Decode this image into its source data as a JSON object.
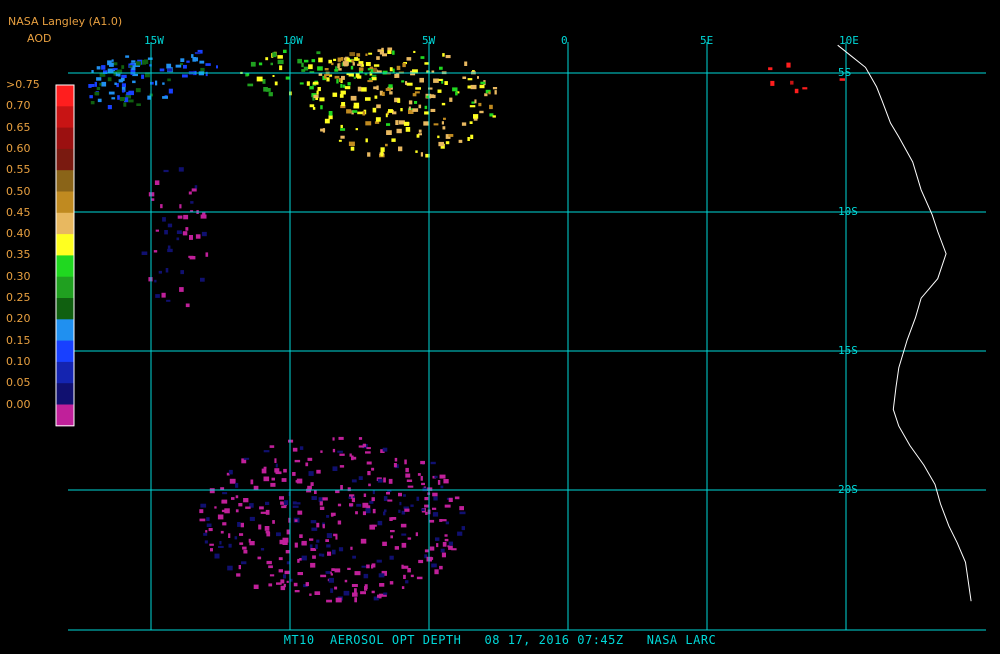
{
  "header": {
    "source": "NASA Langley (A1.0)",
    "variable": "AOD"
  },
  "footer": {
    "caption": "MT10  AEROSOL OPT DEPTH   08 17, 2016 07:45Z   NASA LARC"
  },
  "map": {
    "lon_range": [
      -18,
      12
    ],
    "lat_range": [
      -4,
      -24
    ],
    "coastline_color": "#ffffff",
    "grid_color": "#00d8d8",
    "lon_ticks": [
      {
        "lon": -15,
        "label": "15W"
      },
      {
        "lon": -10,
        "label": "10W"
      },
      {
        "lon": -5,
        "label": "5W"
      },
      {
        "lon": 0,
        "label": "0"
      },
      {
        "lon": 5,
        "label": "5E"
      },
      {
        "lon": 10,
        "label": "10E"
      }
    ],
    "lat_ticks": [
      {
        "lat": -5,
        "label": "5S"
      },
      {
        "lat": -10,
        "label": "10S"
      },
      {
        "lat": -15,
        "label": "15S"
      },
      {
        "lat": -20,
        "label": "20S"
      }
    ],
    "coastline": [
      [
        9.7,
        -4.0
      ],
      [
        10.2,
        -4.4
      ],
      [
        10.7,
        -4.8
      ],
      [
        11.1,
        -5.5
      ],
      [
        11.3,
        -6.0
      ],
      [
        11.6,
        -6.8
      ],
      [
        11.9,
        -7.3
      ],
      [
        12.4,
        -8.2
      ],
      [
        12.7,
        -9.2
      ],
      [
        13.1,
        -10.1
      ],
      [
        13.3,
        -10.7
      ],
      [
        13.6,
        -11.5
      ],
      [
        13.3,
        -12.4
      ],
      [
        12.7,
        -13.1
      ],
      [
        12.5,
        -13.8
      ],
      [
        12.2,
        -14.6
      ],
      [
        11.9,
        -15.6
      ],
      [
        11.8,
        -16.3
      ],
      [
        11.7,
        -17.1
      ],
      [
        11.9,
        -17.7
      ],
      [
        12.3,
        -18.4
      ],
      [
        12.8,
        -19.1
      ],
      [
        13.2,
        -19.8
      ],
      [
        13.4,
        -20.5
      ],
      [
        13.7,
        -21.3
      ],
      [
        14.0,
        -21.9
      ],
      [
        14.3,
        -22.6
      ],
      [
        14.4,
        -23.3
      ],
      [
        14.5,
        -24.0
      ]
    ],
    "aod_regions": [
      {
        "name": "blue cluster near 15W",
        "lon": -16.0,
        "lat": -5.3,
        "rx": 1.8,
        "ry": 1.0,
        "aod": 0.2,
        "density": 0.55
      },
      {
        "name": "blue cluster 13W",
        "lon": -13.6,
        "lat": -4.6,
        "rx": 1.0,
        "ry": 0.5,
        "aod": 0.18,
        "density": 0.5
      },
      {
        "name": "green band 10W",
        "lon": -9.5,
        "lat": -5.0,
        "rx": 2.5,
        "ry": 0.9,
        "aod": 0.35,
        "density": 0.35
      },
      {
        "name": "yellow band 7W",
        "lon": -6.0,
        "lat": -6.0,
        "rx": 3.5,
        "ry": 2.0,
        "aod": 0.42,
        "density": 0.3
      },
      {
        "name": "orange streaks 8W",
        "lon": -7.5,
        "lat": -4.7,
        "rx": 1.7,
        "ry": 0.6,
        "aod": 0.48,
        "density": 0.35
      },
      {
        "name": "red points 8E",
        "lon": 8.2,
        "lat": -5.3,
        "rx": 1.8,
        "ry": 0.8,
        "aod": 0.75,
        "density": 0.05
      },
      {
        "name": "magenta trail 14W",
        "lon": -14.2,
        "lat": -10.8,
        "rx": 1.2,
        "ry": 2.8,
        "aod": 0.0,
        "density": 0.15
      },
      {
        "name": "magenta field south",
        "lon": -8.5,
        "lat": -21.0,
        "rx": 4.8,
        "ry": 3.0,
        "aod": 0.0,
        "density": 0.28
      }
    ]
  },
  "legend": {
    "title": "",
    "entries": [
      {
        "label": ">0.75",
        "color": "#ff1e1e"
      },
      {
        "label": "0.70",
        "color": "#c81414"
      },
      {
        "label": "0.65",
        "color": "#9b1010"
      },
      {
        "label": "0.60",
        "color": "#7a1a10"
      },
      {
        "label": "0.55",
        "color": "#8a6418"
      },
      {
        "label": "0.50",
        "color": "#c08a20"
      },
      {
        "label": "0.45",
        "color": "#e8b860"
      },
      {
        "label": "0.40",
        "color": "#ffff20"
      },
      {
        "label": "0.35",
        "color": "#20d820"
      },
      {
        "label": "0.30",
        "color": "#20a020"
      },
      {
        "label": "0.25",
        "color": "#106010"
      },
      {
        "label": "0.20",
        "color": "#2090f0"
      },
      {
        "label": "0.15",
        "color": "#1840ff"
      },
      {
        "label": "0.10",
        "color": "#1424b0"
      },
      {
        "label": "0.05",
        "color": "#101070"
      },
      {
        "label": "0.00",
        "color": "#c0209a"
      }
    ]
  }
}
